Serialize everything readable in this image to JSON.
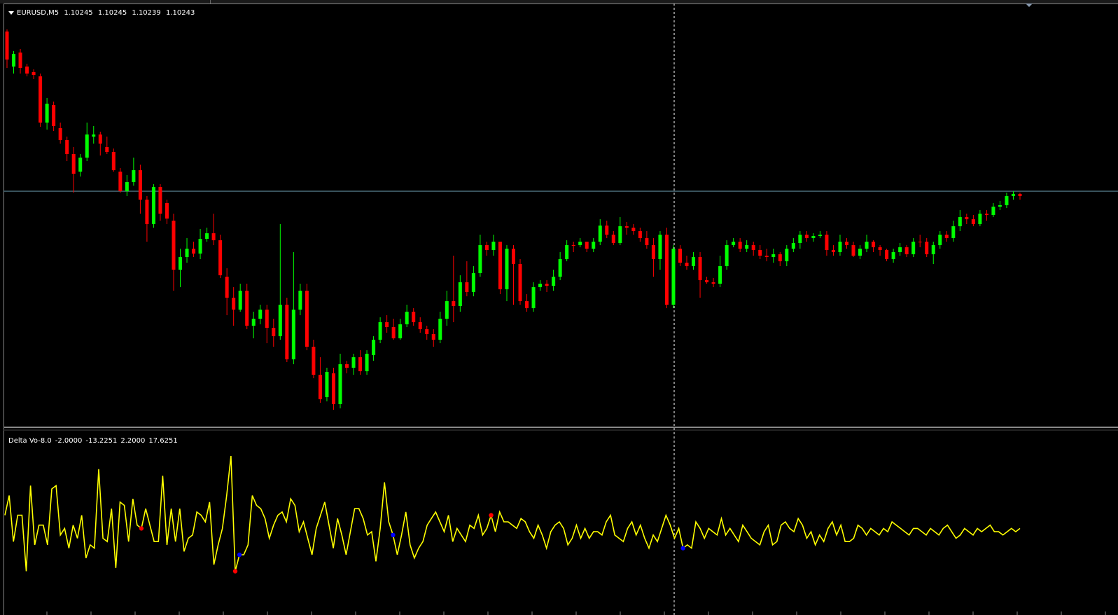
{
  "colors": {
    "bull": "#00ff00",
    "bear": "#ff0000",
    "indicator": "#ffff00",
    "peak": "#ff0000",
    "trough": "#0000ff",
    "crosshair": "#ffffff",
    "priceline": "#6fa3b8"
  },
  "main_panel": {
    "symbol": "EURUSD,M5",
    "open": "1.10245",
    "high": "1.10245",
    "low": "1.10239",
    "close": "1.10243"
  },
  "indicator_panel": {
    "name": "Delta Vo-8.0",
    "values": [
      "-2.0000",
      "-13.2251",
      "2.2000",
      "17.6251"
    ]
  },
  "chart_data": [
    {
      "type": "candlestick",
      "title": "EURUSD,M5",
      "note": "y values in pixel-normalized price units (approx.)",
      "candles": [
        [
          40,
          80,
          37,
          92
        ],
        [
          90,
          72,
          68,
          100
        ],
        [
          70,
          92,
          65,
          100
        ],
        [
          90,
          100,
          86,
          104
        ],
        [
          98,
          102,
          94,
          108
        ],
        [
          104,
          170,
          100,
          176
        ],
        [
          170,
          143,
          135,
          180
        ],
        [
          145,
          175,
          140,
          182
        ],
        [
          178,
          195,
          170,
          200
        ],
        [
          195,
          215,
          190,
          225
        ],
        [
          215,
          243,
          205,
          270
        ],
        [
          240,
          220,
          215,
          247
        ],
        [
          220,
          187,
          170,
          225
        ],
        [
          190,
          187,
          175,
          200
        ],
        [
          187,
          200,
          183,
          217
        ],
        [
          205,
          212,
          190,
          215
        ],
        [
          212,
          238,
          207,
          240
        ],
        [
          240,
          268,
          235,
          270
        ],
        [
          268,
          255,
          245,
          275
        ],
        [
          255,
          238,
          220,
          260
        ],
        [
          238,
          280,
          230,
          300
        ],
        [
          280,
          315,
          275,
          340
        ],
        [
          315,
          262,
          258,
          320
        ],
        [
          262,
          300,
          258,
          310
        ],
        [
          285,
          307,
          280,
          315
        ],
        [
          310,
          380,
          300,
          410
        ],
        [
          380,
          362,
          350,
          405
        ],
        [
          362,
          350,
          335,
          370
        ],
        [
          350,
          357,
          340,
          362
        ],
        [
          357,
          336,
          322,
          365
        ],
        [
          336,
          328,
          320,
          340
        ],
        [
          328,
          338,
          300,
          345
        ],
        [
          338,
          388,
          330,
          392
        ],
        [
          390,
          420,
          378,
          445
        ],
        [
          420,
          437,
          405,
          460
        ],
        [
          437,
          410,
          400,
          440
        ],
        [
          410,
          460,
          400,
          465
        ],
        [
          460,
          450,
          440,
          478
        ],
        [
          450,
          437,
          430,
          458
        ],
        [
          437,
          463,
          430,
          485
        ],
        [
          463,
          475,
          450,
          490
        ],
        [
          475,
          430,
          315,
          480
        ],
        [
          430,
          508,
          420,
          512
        ],
        [
          508,
          437,
          355,
          515
        ],
        [
          437,
          410,
          400,
          445
        ],
        [
          410,
          490,
          400,
          495
        ],
        [
          490,
          530,
          480,
          535
        ],
        [
          530,
          565,
          505,
          570
        ],
        [
          562,
          526,
          520,
          568
        ],
        [
          528,
          572,
          520,
          580
        ],
        [
          572,
          515,
          500,
          578
        ],
        [
          515,
          520,
          510,
          528
        ],
        [
          520,
          505,
          500,
          530
        ],
        [
          505,
          525,
          495,
          530
        ],
        [
          525,
          500,
          495,
          530
        ],
        [
          502,
          480,
          475,
          510
        ],
        [
          480,
          455,
          448,
          485
        ],
        [
          455,
          462,
          445,
          470
        ],
        [
          462,
          478,
          450,
          480
        ],
        [
          478,
          458,
          450,
          480
        ],
        [
          458,
          440,
          430,
          462
        ],
        [
          440,
          455,
          435,
          460
        ],
        [
          455,
          465,
          448,
          470
        ],
        [
          465,
          472,
          460,
          480
        ],
        [
          472,
          480,
          465,
          490
        ],
        [
          480,
          450,
          440,
          485
        ],
        [
          450,
          425,
          410,
          460
        ],
        [
          425,
          432,
          360,
          455
        ],
        [
          432,
          398,
          388,
          440
        ],
        [
          398,
          412,
          368,
          418
        ],
        [
          412,
          385,
          375,
          418
        ],
        [
          385,
          345,
          330,
          390
        ],
        [
          345,
          352,
          340,
          360
        ],
        [
          352,
          340,
          330,
          360
        ],
        [
          340,
          408,
          350,
          415
        ],
        [
          408,
          350,
          345,
          425
        ],
        [
          350,
          372,
          345,
          430
        ],
        [
          372,
          425,
          365,
          430
        ],
        [
          425,
          435,
          415,
          440
        ],
        [
          435,
          405,
          398,
          440
        ],
        [
          405,
          400,
          395,
          410
        ],
        [
          400,
          403,
          395,
          412
        ],
        [
          403,
          390,
          380,
          410
        ],
        [
          390,
          365,
          355,
          395
        ],
        [
          365,
          345,
          338,
          368
        ],
        [
          345,
          345,
          340,
          355
        ],
        [
          345,
          340,
          335,
          348
        ],
        [
          340,
          350,
          342,
          355
        ],
        [
          350,
          340,
          335,
          355
        ],
        [
          340,
          317,
          308,
          345
        ],
        [
          317,
          330,
          310,
          335
        ],
        [
          330,
          342,
          325,
          345
        ],
        [
          342,
          318,
          305,
          345
        ],
        [
          318,
          320,
          312,
          330
        ],
        [
          320,
          325,
          315,
          330
        ],
        [
          325,
          335,
          320,
          340
        ],
        [
          335,
          345,
          325,
          350
        ],
        [
          345,
          365,
          335,
          390
        ],
        [
          365,
          330,
          325,
          380
        ],
        [
          330,
          430,
          320,
          435
        ],
        [
          430,
          350,
          345,
          435
        ],
        [
          350,
          370,
          345,
          375
        ],
        [
          370,
          375,
          360,
          380
        ],
        [
          375,
          362,
          355,
          380
        ],
        [
          362,
          395,
          355,
          420
        ],
        [
          395,
          398,
          390,
          400
        ],
        [
          398,
          400,
          392,
          405
        ],
        [
          400,
          375,
          360,
          405
        ],
        [
          375,
          345,
          338,
          380
        ],
        [
          345,
          340,
          335,
          348
        ],
        [
          340,
          350,
          335,
          355
        ],
        [
          350,
          345,
          338,
          355
        ],
        [
          345,
          352,
          340,
          360
        ],
        [
          352,
          360,
          345,
          365
        ],
        [
          360,
          362,
          350,
          368
        ],
        [
          362,
          358,
          350,
          370
        ],
        [
          358,
          368,
          355,
          375
        ],
        [
          368,
          350,
          345,
          375
        ],
        [
          350,
          342,
          335,
          355
        ],
        [
          342,
          330,
          325,
          350
        ],
        [
          330,
          335,
          325,
          340
        ],
        [
          335,
          332,
          328,
          340
        ],
        [
          332,
          330,
          325,
          335
        ],
        [
          330,
          352,
          325,
          360
        ],
        [
          352,
          355,
          345,
          360
        ],
        [
          355,
          340,
          330,
          360
        ],
        [
          340,
          345,
          335,
          350
        ],
        [
          345,
          360,
          340,
          362
        ],
        [
          360,
          350,
          345,
          365
        ],
        [
          350,
          340,
          330,
          355
        ],
        [
          340,
          348,
          338,
          355
        ],
        [
          348,
          352,
          345,
          360
        ],
        [
          352,
          365,
          350,
          368
        ],
        [
          365,
          355,
          350,
          370
        ],
        [
          355,
          348,
          342,
          360
        ],
        [
          348,
          358,
          345,
          362
        ],
        [
          358,
          340,
          335,
          362
        ],
        [
          340,
          340,
          330,
          348
        ],
        [
          340,
          358,
          335,
          362
        ],
        [
          358,
          345,
          340,
          372
        ],
        [
          345,
          330,
          325,
          350
        ],
        [
          330,
          335,
          325,
          340
        ],
        [
          335,
          318,
          310,
          340
        ],
        [
          318,
          305,
          295,
          325
        ],
        [
          305,
          308,
          300,
          315
        ],
        [
          308,
          315,
          302,
          318
        ],
        [
          315,
          300,
          295,
          318
        ],
        [
          300,
          302,
          295,
          310
        ],
        [
          302,
          290,
          285,
          305
        ],
        [
          290,
          288,
          282,
          295
        ],
        [
          288,
          275,
          270,
          292
        ],
        [
          275,
          272,
          268,
          280
        ],
        [
          272,
          275,
          270,
          280
        ]
      ]
    },
    {
      "type": "line",
      "title": "Delta Vo-8.0",
      "x": [
        1,
        2,
        3,
        4,
        5,
        6,
        7,
        8,
        9,
        10,
        11,
        12,
        13,
        14,
        15,
        16,
        17,
        18,
        19,
        20,
        21,
        22,
        23,
        24,
        25,
        26,
        27,
        28,
        29,
        30,
        31,
        32,
        33,
        34,
        35,
        36,
        37,
        38,
        39,
        40,
        41,
        42,
        43,
        44,
        45,
        46,
        47,
        48,
        49,
        50,
        51,
        52,
        53,
        54,
        55,
        56,
        57,
        58,
        59,
        60,
        61,
        62,
        63,
        64,
        65,
        66,
        67,
        68,
        69,
        70,
        71,
        72,
        73,
        74,
        75,
        76,
        77,
        78,
        79,
        80,
        81,
        82,
        83,
        84,
        85,
        86,
        87,
        88,
        89,
        90,
        91,
        92,
        93,
        94,
        95,
        96,
        97,
        98,
        99,
        100,
        101,
        102,
        103,
        104,
        105,
        106,
        107,
        108,
        109,
        110,
        111,
        112,
        113,
        114,
        115,
        116,
        117,
        118,
        119,
        120,
        121,
        122,
        123,
        124,
        125,
        126,
        127,
        128,
        129,
        130,
        131,
        132,
        133,
        134,
        135,
        136,
        137,
        138,
        139,
        140,
        141,
        142,
        143,
        144,
        145,
        146,
        147,
        148,
        149,
        150,
        151,
        152,
        153,
        154,
        155,
        156,
        157,
        158,
        159,
        160,
        161,
        162,
        163,
        164,
        165,
        166,
        167,
        168,
        169,
        170,
        171,
        172,
        173,
        174,
        175,
        176,
        177,
        178,
        179,
        180,
        181,
        182,
        183,
        184,
        185,
        186,
        187,
        188,
        189,
        190,
        191,
        192,
        193,
        194,
        195,
        196,
        197,
        198,
        199,
        200,
        201,
        202,
        203,
        204,
        205,
        206,
        207,
        208,
        209,
        210,
        211,
        212,
        213,
        214,
        215,
        216,
        217,
        218,
        219,
        220,
        221,
        222,
        223,
        224,
        225,
        226,
        227,
        228,
        229,
        230,
        231,
        232,
        233,
        234,
        235,
        236,
        237,
        238,
        239,
        240
      ],
      "values": [
        -8,
        -2,
        -16,
        -8,
        -8,
        -25,
        1,
        -17,
        -11,
        -11,
        -17,
        0,
        1,
        -14,
        -12,
        -18,
        -11,
        -15,
        -8,
        -21,
        -17,
        -18,
        6,
        -15,
        -16,
        -6,
        -24,
        -4,
        -5,
        -16,
        -3,
        -11,
        -12,
        -6,
        -11,
        -16,
        -16,
        4,
        -17,
        -6,
        -16,
        -6,
        -19,
        -15,
        -14,
        -7,
        -8,
        -10,
        -4,
        -23,
        -17,
        -12,
        -2,
        10,
        -25,
        -20,
        -20,
        -17,
        -2,
        -5,
        -6,
        -9,
        -15,
        -11,
        -8,
        -7,
        -10,
        -3,
        -5,
        -13,
        -10,
        -15,
        -20,
        -12,
        -8,
        -4,
        -11,
        -18,
        -9,
        -14,
        -20,
        -13,
        -6,
        -6,
        -9,
        -14,
        -13,
        -22,
        -12,
        2,
        -10,
        -14,
        -20,
        -14,
        -7,
        -17,
        -21,
        -18,
        -16,
        -11,
        -9,
        -7,
        -10,
        -13,
        -8,
        -16,
        -12,
        -14,
        -16,
        -11,
        -12,
        -8,
        -14,
        -12,
        -8,
        -13,
        -7,
        -10,
        -10,
        -11,
        -12,
        -9,
        -10,
        -13,
        -15,
        -11,
        -14,
        -18,
        -13,
        -11,
        -10,
        -12,
        -17,
        -15,
        -11,
        -15,
        -12,
        -15,
        -13,
        -13,
        -14,
        -10,
        -8,
        -14,
        -15,
        -16,
        -12,
        -10,
        -14,
        -11,
        -15,
        -18,
        -14,
        -16,
        -12,
        -8,
        -11,
        -15,
        -12,
        -18,
        -17,
        -18,
        -10,
        -12,
        -15,
        -12,
        -13,
        -14,
        -9,
        -14,
        -12,
        -14,
        -16,
        -11,
        -13,
        -15,
        -16,
        -17,
        -13,
        -11,
        -17,
        -16,
        -11,
        -10,
        -12,
        -13,
        -9,
        -11,
        -15,
        -13,
        -17,
        -14,
        -16,
        -12,
        -10,
        -14,
        -11,
        -16,
        -16,
        -15,
        -11,
        -12,
        -14,
        -12,
        -13,
        -14,
        -12,
        -13,
        -10,
        -11,
        -12,
        -13,
        -14,
        -12,
        -12,
        -13,
        -14,
        -12,
        -13,
        -14,
        -12,
        -11,
        -13,
        -15,
        -14,
        -12,
        -13,
        -14,
        -12,
        -13,
        -12,
        -11,
        -13,
        -13,
        -14,
        -13,
        -12,
        -13,
        -12
      ],
      "peaks": [
        {
          "index": 32,
          "type": "high"
        },
        {
          "index": 54,
          "type": "high"
        },
        {
          "index": 114,
          "type": "high"
        }
      ],
      "troughs": [
        {
          "index": 55,
          "type": "low"
        },
        {
          "index": 91,
          "type": "low"
        },
        {
          "index": 159,
          "type": "low"
        }
      ]
    }
  ]
}
